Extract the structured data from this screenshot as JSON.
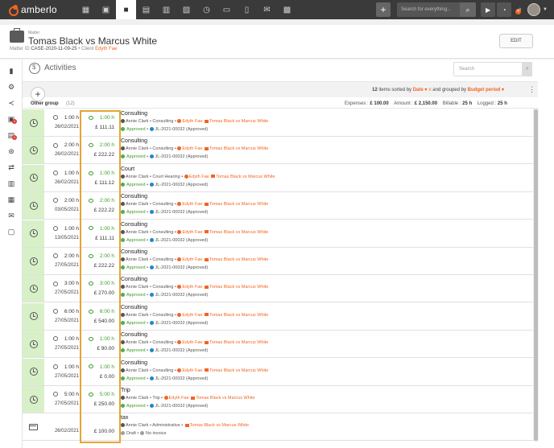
{
  "app": {
    "brand": "amberlo",
    "nav_icons": [
      "dashboard-icon",
      "contacts-icon",
      "matters-icon",
      "documents-icon",
      "bank-icon",
      "calendar-icon",
      "timer-history-icon",
      "folder-icon",
      "invoice-icon",
      "mail-icon",
      "reports-icon"
    ],
    "search_placeholder": "Search for everything...",
    "notification_count": "4"
  },
  "matter": {
    "label": "Matter",
    "title": "Tomas Black vs Marcus White",
    "id_label": "Matter ID",
    "id_value": "CASE-2020-11-09-25",
    "separator": "•",
    "client_label": "Client",
    "client_value": "Edyth Fae",
    "edit_label": "EDIT"
  },
  "activities": {
    "title": "Activities",
    "search_placeholder": "Search",
    "items_count": "12",
    "items_label": "items sorted by",
    "sorted_by": "Date",
    "grouped_label": "and grouped by",
    "grouped_by": "Budget period",
    "group": {
      "name": "Other group",
      "count": "(12)",
      "expenses_label": "Expenses :",
      "expenses_value": "£ 100.00",
      "amount_label": "Amount :",
      "amount_value": "£ 2,150.00",
      "billable_label": "Billable :",
      "billable_value": "25 h",
      "logged_label": "Logged :",
      "logged_value": "25 h"
    },
    "rows": [
      {
        "type": "time",
        "duration": "1:00 h",
        "date": "26/02/2021",
        "billed_duration": "1:00 h",
        "amount": "£ 111.11",
        "title": "Consulting",
        "person": "Annie Clark",
        "activity": "Consulting",
        "client": "Edyth Fae",
        "matter": "Tomas Black vs Marcus White",
        "status": "Approved",
        "invoice": "JL-2021-00032 (Approved)"
      },
      {
        "type": "time",
        "duration": "2:00 h",
        "date": "26/02/2021",
        "billed_duration": "2:00 h",
        "amount": "£ 222.22",
        "title": "Consulting",
        "person": "Annie Clark",
        "activity": "Consulting",
        "client": "Edyth Fae",
        "matter": "Tomas Black vs Marcus White",
        "status": "Approved",
        "invoice": "JL-2021-00032 (Approved)"
      },
      {
        "type": "time",
        "duration": "1:00 h",
        "date": "26/02/2021",
        "billed_duration": "1:00 h",
        "amount": "£ 111.12",
        "title": "Court",
        "person": "Annie Clark",
        "activity": "Court Hearing",
        "client": "Edyth Fae",
        "matter": "Tomas Black vs Marcus White",
        "status": "Approved",
        "invoice": "JL-2021-00032 (Approved)"
      },
      {
        "type": "time",
        "duration": "2:00 h",
        "date": "03/05/2021",
        "billed_duration": "2:00 h",
        "amount": "£ 222.22",
        "title": "Consulting",
        "person": "Annie Clark",
        "activity": "Consulting",
        "client": "Edyth Fae",
        "matter": "Tomas Black vs Marcus White",
        "status": "Approved",
        "invoice": "JL-2021-00032 (Approved)"
      },
      {
        "type": "time",
        "duration": "1:00 h",
        "date": "13/05/2021",
        "billed_duration": "1:00 h",
        "amount": "£ 111.11",
        "title": "Consulting",
        "person": "Annie Clark",
        "activity": "Consulting",
        "client": "Edyth Fae",
        "matter": "Tomas Black vs Marcus White",
        "status": "Approved",
        "invoice": "JL-2021-00032 (Approved)"
      },
      {
        "type": "time",
        "duration": "2:00 h",
        "date": "27/05/2021",
        "billed_duration": "2:00 h",
        "amount": "£ 222.22",
        "title": "Consulting",
        "person": "Annie Clark",
        "activity": "Consulting",
        "client": "Edyth Fae",
        "matter": "Tomas Black vs Marcus White",
        "status": "Approved",
        "invoice": "JL-2021-00032 (Approved)"
      },
      {
        "type": "time",
        "duration": "3:00 h",
        "date": "27/05/2021",
        "billed_duration": "3:00 h",
        "amount": "£ 270.00",
        "title": "Consulting",
        "person": "Annie Clark",
        "activity": "Consulting",
        "client": "Edyth Fae",
        "matter": "Tomas Black vs Marcus White",
        "status": "Approved",
        "invoice": "JL-2021-00032 (Approved)"
      },
      {
        "type": "time",
        "duration": "6:00 h",
        "date": "27/05/2021",
        "billed_duration": "6:00 h",
        "amount": "£ 540.00",
        "title": "Consulting",
        "person": "Annie Clark",
        "activity": "Consulting",
        "client": "Edyth Fae",
        "matter": "Tomas Black vs Marcus White",
        "status": "Approved",
        "invoice": "JL-2021-00032 (Approved)"
      },
      {
        "type": "time",
        "duration": "1:00 h",
        "date": "27/05/2021",
        "billed_duration": "1:00 h",
        "amount": "£ 90.00",
        "title": "Consulting",
        "person": "Annie Clark",
        "activity": "Consulting",
        "client": "Edyth Fae",
        "matter": "Tomas Black vs Marcus White",
        "status": "Approved",
        "invoice": "JL-2021-00032 (Approved)"
      },
      {
        "type": "time",
        "duration": "1:00 h",
        "date": "27/05/2021",
        "billed_duration": "1:00 h",
        "amount": "£ 0.00",
        "title": "Consulting",
        "person": "Annie Clark",
        "activity": "Consulting",
        "client": "Edyth Fae",
        "matter": "Tomas Black vs Marcus White",
        "status": "Approved",
        "invoice": "JL-2021-00032 (Approved)"
      },
      {
        "type": "time",
        "duration": "5:00 h",
        "date": "27/05/2021",
        "billed_duration": "5:00 h",
        "amount": "£ 250.00",
        "title": "Trip",
        "person": "Annie Clark",
        "activity": "Trip",
        "client": "Edyth Fae",
        "matter": "Tomas Black vs Marcus White",
        "status": "Approved",
        "invoice": "JL-2021-00032 (Approved)"
      },
      {
        "type": "expense",
        "duration": "",
        "date": "26/02/2021",
        "billed_duration": "",
        "amount": "£ 100.00",
        "title": "tax",
        "person": "Annie Clark",
        "activity": "Administrative",
        "client": "",
        "matter": "Tomas Black vs Marcus White",
        "status": "Draft",
        "invoice": "No invoice"
      }
    ]
  },
  "colors": {
    "brand_orange": "#f26522",
    "approved_green": "#3c9a28",
    "row_state_green": "#d8f0c8",
    "highlight_border": "#e6a534",
    "topbar_dark": "#3a3a3a"
  }
}
